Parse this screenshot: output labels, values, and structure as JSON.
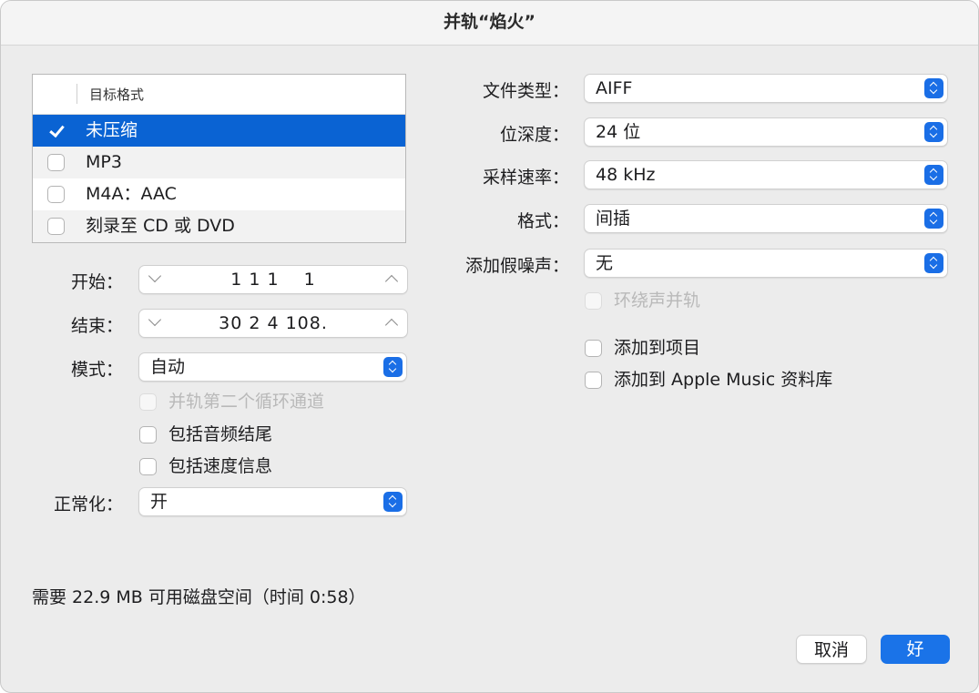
{
  "window": {
    "title": "并轨“焰火”"
  },
  "format_list": {
    "header": "目标格式",
    "items": [
      {
        "label": "未压缩",
        "checked": true
      },
      {
        "label": "MP3",
        "checked": false
      },
      {
        "label": "M4A：AAC",
        "checked": false
      },
      {
        "label": "刻录至 CD 或 DVD",
        "checked": false
      }
    ]
  },
  "range": {
    "start_label": "开始：",
    "start_value": "1 1 1 　1",
    "end_label": "结束：",
    "end_value": "30 2 4 108."
  },
  "mode": {
    "label": "模式：",
    "value": "自动"
  },
  "options_left": {
    "bounce_second_cycle": "并轨第二个循环通道",
    "include_audio_tail": "包括音频结尾",
    "include_tempo": "包括速度信息"
  },
  "normalize": {
    "label": "正常化：",
    "value": "开"
  },
  "right": {
    "file_type_label": "文件类型：",
    "file_type_value": "AIFF",
    "bit_depth_label": "位深度：",
    "bit_depth_value": "24 位",
    "sample_rate_label": "采样速率：",
    "sample_rate_value": "48 kHz",
    "format_label": "格式：",
    "format_value": "间插",
    "dither_label": "添加假噪声：",
    "dither_value": "无",
    "surround_bounce": "环绕声并轨",
    "add_to_project": "添加到项目",
    "add_to_music": "添加到 Apple Music 资料库"
  },
  "footer": {
    "info": "需要 22.9 MB 可用磁盘空间（时间 0:58）",
    "cancel_label": "取消",
    "ok_label": "好"
  },
  "colors": {
    "accent": "#1a73e8",
    "selection": "#0a63d3"
  }
}
